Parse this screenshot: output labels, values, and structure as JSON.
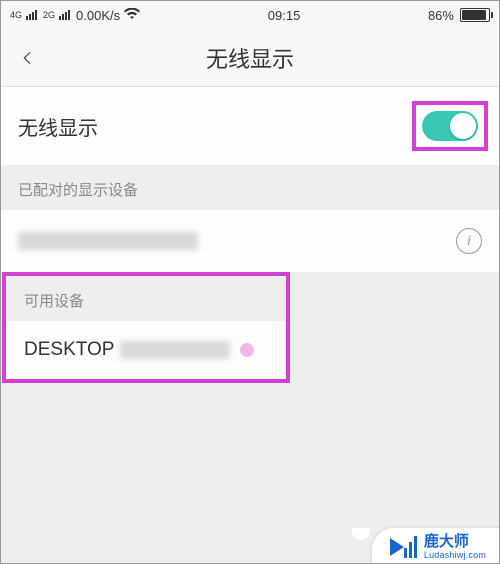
{
  "status_bar": {
    "net1_label": "4G",
    "net2_label": "2G",
    "speed": "0.00K/s",
    "time": "09:15",
    "battery_pct": "86%"
  },
  "header": {
    "title": "无线显示"
  },
  "toggle_row": {
    "label": "无线显示",
    "on": true
  },
  "sections": {
    "paired_header": "已配对的显示设备",
    "available_header": "可用设备"
  },
  "paired_device": {
    "name_redacted": true,
    "info_char": "i"
  },
  "available_device": {
    "name_visible_part": "DESKTOP",
    "name_redacted_suffix": true
  },
  "branding": {
    "name": "鹿大师",
    "url": "Ludashiwj.com"
  },
  "colors": {
    "accent": "#3ac7b5",
    "highlight": "#d63fd6",
    "brand": "#1865d1"
  }
}
